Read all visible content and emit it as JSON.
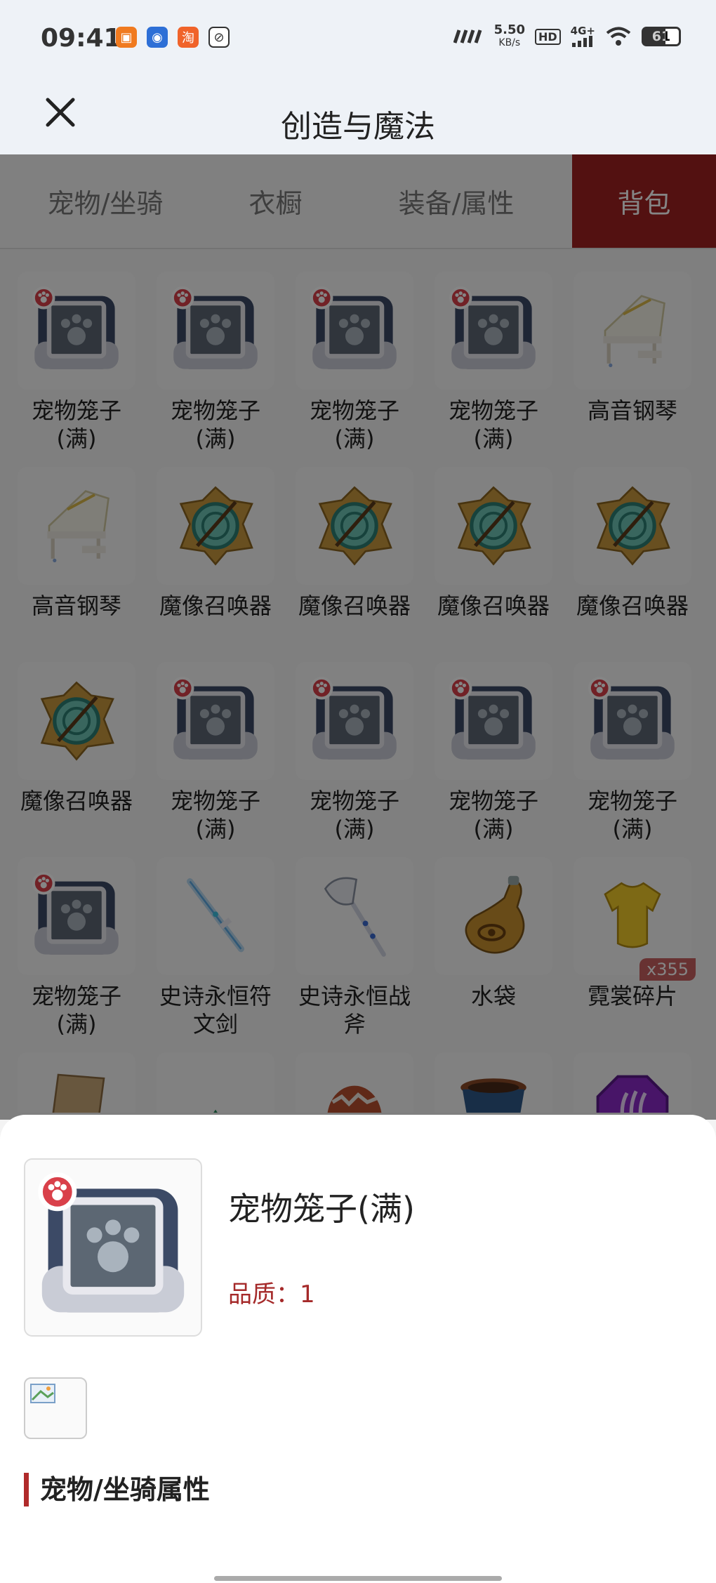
{
  "status_bar": {
    "time": "09:41",
    "speed_top": "5.50",
    "speed_unit": "KB/s",
    "network": "4G+",
    "hd": "HD",
    "battery": "61",
    "battery_level": 0.61
  },
  "header": {
    "title": "创造与魔法"
  },
  "tabs": [
    {
      "label": "宠物/坐骑",
      "active": false
    },
    {
      "label": "衣橱",
      "active": false
    },
    {
      "label": "装备/属性",
      "active": false
    },
    {
      "label": "背包",
      "active": true
    }
  ],
  "grid": {
    "items": [
      {
        "label": "宠物笼子\n(满)",
        "icon": "pet-cage-icon"
      },
      {
        "label": "宠物笼子\n(满)",
        "icon": "pet-cage-icon"
      },
      {
        "label": "宠物笼子\n(满)",
        "icon": "pet-cage-icon"
      },
      {
        "label": "宠物笼子\n(满)",
        "icon": "pet-cage-icon"
      },
      {
        "label": "高音钢琴",
        "icon": "piano-icon"
      },
      {
        "label": "高音钢琴",
        "icon": "piano-icon"
      },
      {
        "label": "魔像召唤器",
        "icon": "golem-summoner-icon"
      },
      {
        "label": "魔像召唤器",
        "icon": "golem-summoner-icon"
      },
      {
        "label": "魔像召唤器",
        "icon": "golem-summoner-icon"
      },
      {
        "label": "魔像召唤器",
        "icon": "golem-summoner-icon"
      },
      {
        "label": "魔像召唤器",
        "icon": "golem-summoner-icon"
      },
      {
        "label": "宠物笼子\n(满)",
        "icon": "pet-cage-icon"
      },
      {
        "label": "宠物笼子\n(满)",
        "icon": "pet-cage-icon"
      },
      {
        "label": "宠物笼子\n(满)",
        "icon": "pet-cage-icon"
      },
      {
        "label": "宠物笼子\n(满)",
        "icon": "pet-cage-icon"
      },
      {
        "label": "宠物笼子\n(满)",
        "icon": "pet-cage-icon"
      },
      {
        "label": "史诗永恒符\n文剑",
        "icon": "sword-icon"
      },
      {
        "label": "史诗永恒战\n斧",
        "icon": "axe-icon"
      },
      {
        "label": "水袋",
        "icon": "water-bag-icon"
      },
      {
        "label": "霓裳碎片",
        "icon": "shirt-fragment-icon",
        "badge": "x355"
      },
      {
        "label": "",
        "icon": "scroll-icon"
      },
      {
        "label": "",
        "icon": "gem-icon"
      },
      {
        "label": "",
        "icon": "egg-icon"
      },
      {
        "label": "",
        "icon": "flower-pot-icon"
      },
      {
        "label": "",
        "icon": "purple-crystal-icon"
      }
    ]
  },
  "detail": {
    "name": "宠物笼子(满)",
    "quality": "品质：1",
    "section_title": "宠物/坐骑属性",
    "icon": "pet-cage-icon"
  },
  "colors": {
    "accent": "#9f2121",
    "quality": "#a52a2a"
  }
}
